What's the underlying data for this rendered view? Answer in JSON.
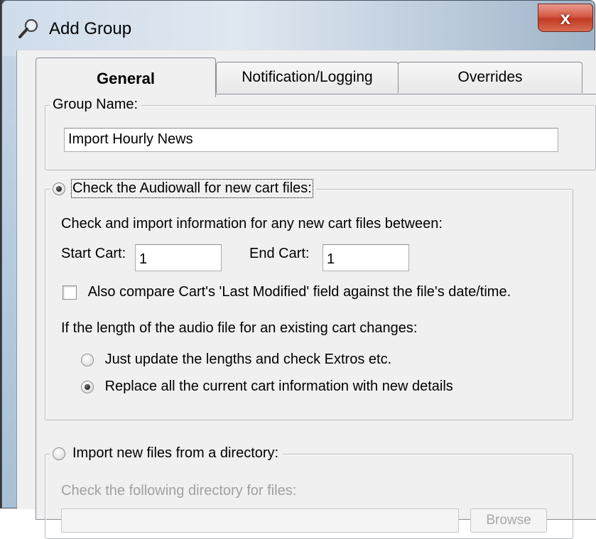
{
  "window": {
    "title": "Add Group",
    "close_label": "x"
  },
  "tabs": [
    {
      "label": "General",
      "active": true
    },
    {
      "label": "Notification/Logging",
      "active": false
    },
    {
      "label": "Overrides",
      "active": false
    }
  ],
  "group_name": {
    "legend": "Group Name:",
    "value": "Import Hourly News"
  },
  "audiowall": {
    "radio_label": "Check the Audiowall for new cart files:",
    "selected": true,
    "description": "Check and import information for any new cart files between:",
    "start_cart_label": "Start Cart:",
    "start_cart_value": "1",
    "end_cart_label": "End Cart:",
    "end_cart_value": "1",
    "compare_label": "Also compare Cart's 'Last Modified' field against the file's date/time.",
    "compare_checked": false,
    "length_change_label": "If the length of the audio file for an existing cart changes:",
    "options": [
      {
        "label": "Just update the lengths and check Extros etc.",
        "selected": false
      },
      {
        "label": "Replace all the current cart information with new details",
        "selected": true
      }
    ]
  },
  "directory": {
    "radio_label": "Import new files from a directory:",
    "selected": false,
    "description": "Check the following directory for files:",
    "browse_label": "Browse"
  }
}
